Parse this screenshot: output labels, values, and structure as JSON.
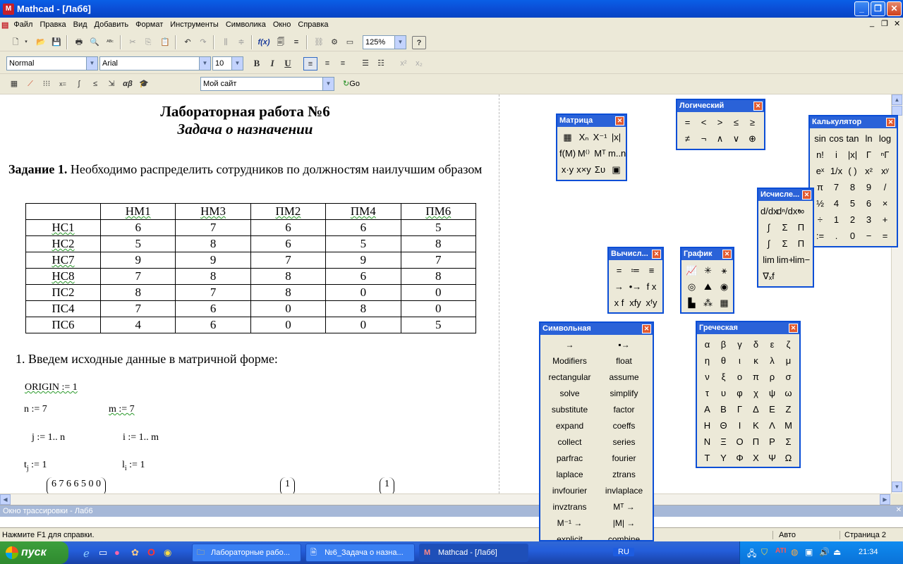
{
  "window": {
    "title": "Mathcad - [Лаб6]"
  },
  "menu": [
    "Файл",
    "Правка",
    "Вид",
    "Добавить",
    "Формат",
    "Инструменты",
    "Символика",
    "Окно",
    "Справка"
  ],
  "toolbar": {
    "zoom": "125%",
    "style": "Normal",
    "font": "Arial",
    "size": "10",
    "bold": "B",
    "italic": "I",
    "underline": "U",
    "site": "Мой сайт",
    "go": "Go"
  },
  "document": {
    "title": "Лабораторная работа №6",
    "subtitle": "Задача о назначении",
    "task_label": "Задание 1.",
    "task_text": " Необходимо распределить сотрудников по должностям наилучшим образом",
    "table": {
      "headers": [
        "",
        "НМ1",
        "НМ3",
        "ПМ2",
        "ПМ4",
        "ПМ6"
      ],
      "rows": [
        [
          "НС1",
          "6",
          "7",
          "6",
          "6",
          "5"
        ],
        [
          "НС2",
          "5",
          "8",
          "6",
          "5",
          "8"
        ],
        [
          "НС7",
          "9",
          "9",
          "7",
          "9",
          "7"
        ],
        [
          "НС8",
          "7",
          "8",
          "8",
          "6",
          "8"
        ],
        [
          "ПС2",
          "8",
          "7",
          "8",
          "0",
          "0"
        ],
        [
          "ПС4",
          "7",
          "6",
          "0",
          "8",
          "0"
        ],
        [
          "ПС6",
          "4",
          "6",
          "0",
          "0",
          "5"
        ]
      ]
    },
    "step1": "1. Введем исходные данные в матричной форме:",
    "origin": "ORIGIN := 1",
    "n_def": "n := 7",
    "m_def": "m := 7",
    "j_def": "j := 1.. n",
    "i_def": "i := 1.. m",
    "t_var": "t",
    "t_sub": "j",
    "t_val": " := 1",
    "l_var": "l",
    "l_sub": "i",
    "l_val": " := 1",
    "matrix_row": "6  7  6  6  5  0  0",
    "vec1": "1",
    "vec2": "1"
  },
  "trace": {
    "title": "Окно трассировки - Лаб6"
  },
  "status": {
    "help": "Нажмите F1 для справки.",
    "mode": "Авто",
    "page": "Страница 2"
  },
  "taskbar": {
    "start": "пуск",
    "tasks": [
      "Лабораторные рабо...",
      "№6_Задача о назна...",
      "Mathcad - [Лаб6]"
    ],
    "lang": "RU",
    "time": "21:34"
  },
  "palettes": {
    "matrix": {
      "title": "Матрица",
      "items": [
        "▦",
        "Xₙ",
        "X⁻¹",
        "|x|",
        "f(M)",
        "M⁽⁾",
        "Mᵀ",
        "m..n",
        "x·y",
        "x×y",
        "Συ",
        "▣"
      ]
    },
    "logic": {
      "title": "Логический",
      "items": [
        "=",
        "<",
        ">",
        "≤",
        "≥",
        "≠",
        "¬",
        "∧",
        "∨",
        "⊕"
      ]
    },
    "calculator": {
      "title": "Калькулятор",
      "items": [
        "sin",
        "cos",
        "tan",
        "ln",
        "log",
        "n!",
        "i",
        "|x|",
        "Γ",
        "ⁿΓ",
        "eˣ",
        "1/x",
        "( )",
        "x²",
        "xʸ",
        "π",
        "7",
        "8",
        "9",
        "/",
        "½",
        "4",
        "5",
        "6",
        "×",
        "÷",
        "1",
        "2",
        "3",
        "+",
        ":=",
        ".",
        "0",
        "−",
        "="
      ]
    },
    "calculus": {
      "title": "Исчисле...",
      "items": [
        "d/dx",
        "dⁿ/dxⁿ",
        "∞",
        "∫",
        "Σ",
        "Π",
        "∫",
        "Σ",
        "Π",
        "lim",
        "lim+",
        "lim−",
        "∇ₓf"
      ]
    },
    "evaluation": {
      "title": "Вычисл...",
      "items": [
        "=",
        "≔",
        "≡",
        "→",
        "•→",
        "f x",
        "x f",
        "xfy",
        "xᶠy"
      ]
    },
    "graph": {
      "title": "График",
      "items": [
        "📈",
        "✳",
        "⚹",
        "◎",
        "⛰",
        "◉",
        "▙",
        "⁂",
        "▦"
      ]
    },
    "symbolic": {
      "title": "Символьная",
      "items": [
        "→",
        "▪→",
        "Modifiers",
        "float",
        "rectangular",
        "assume",
        "solve",
        "simplify",
        "substitute",
        "factor",
        "expand",
        "coeffs",
        "collect",
        "series",
        "parfrac",
        "fourier",
        "laplace",
        "ztrans",
        "invfourier",
        "invlaplace",
        "invztrans",
        "Mᵀ →",
        "M⁻¹ →",
        "|M| →",
        "explicit",
        "combine"
      ]
    },
    "greek": {
      "title": "Греческая",
      "items": [
        "α",
        "β",
        "γ",
        "δ",
        "ε",
        "ζ",
        "η",
        "θ",
        "ι",
        "κ",
        "λ",
        "μ",
        "ν",
        "ξ",
        "ο",
        "π",
        "ρ",
        "σ",
        "τ",
        "υ",
        "φ",
        "χ",
        "ψ",
        "ω",
        "Α",
        "Β",
        "Γ",
        "Δ",
        "Ε",
        "Ζ",
        "Η",
        "Θ",
        "Ι",
        "Κ",
        "Λ",
        "Μ",
        "Ν",
        "Ξ",
        "Ο",
        "Π",
        "Ρ",
        "Σ",
        "Τ",
        "Υ",
        "Φ",
        "Χ",
        "Ψ",
        "Ω"
      ]
    }
  }
}
